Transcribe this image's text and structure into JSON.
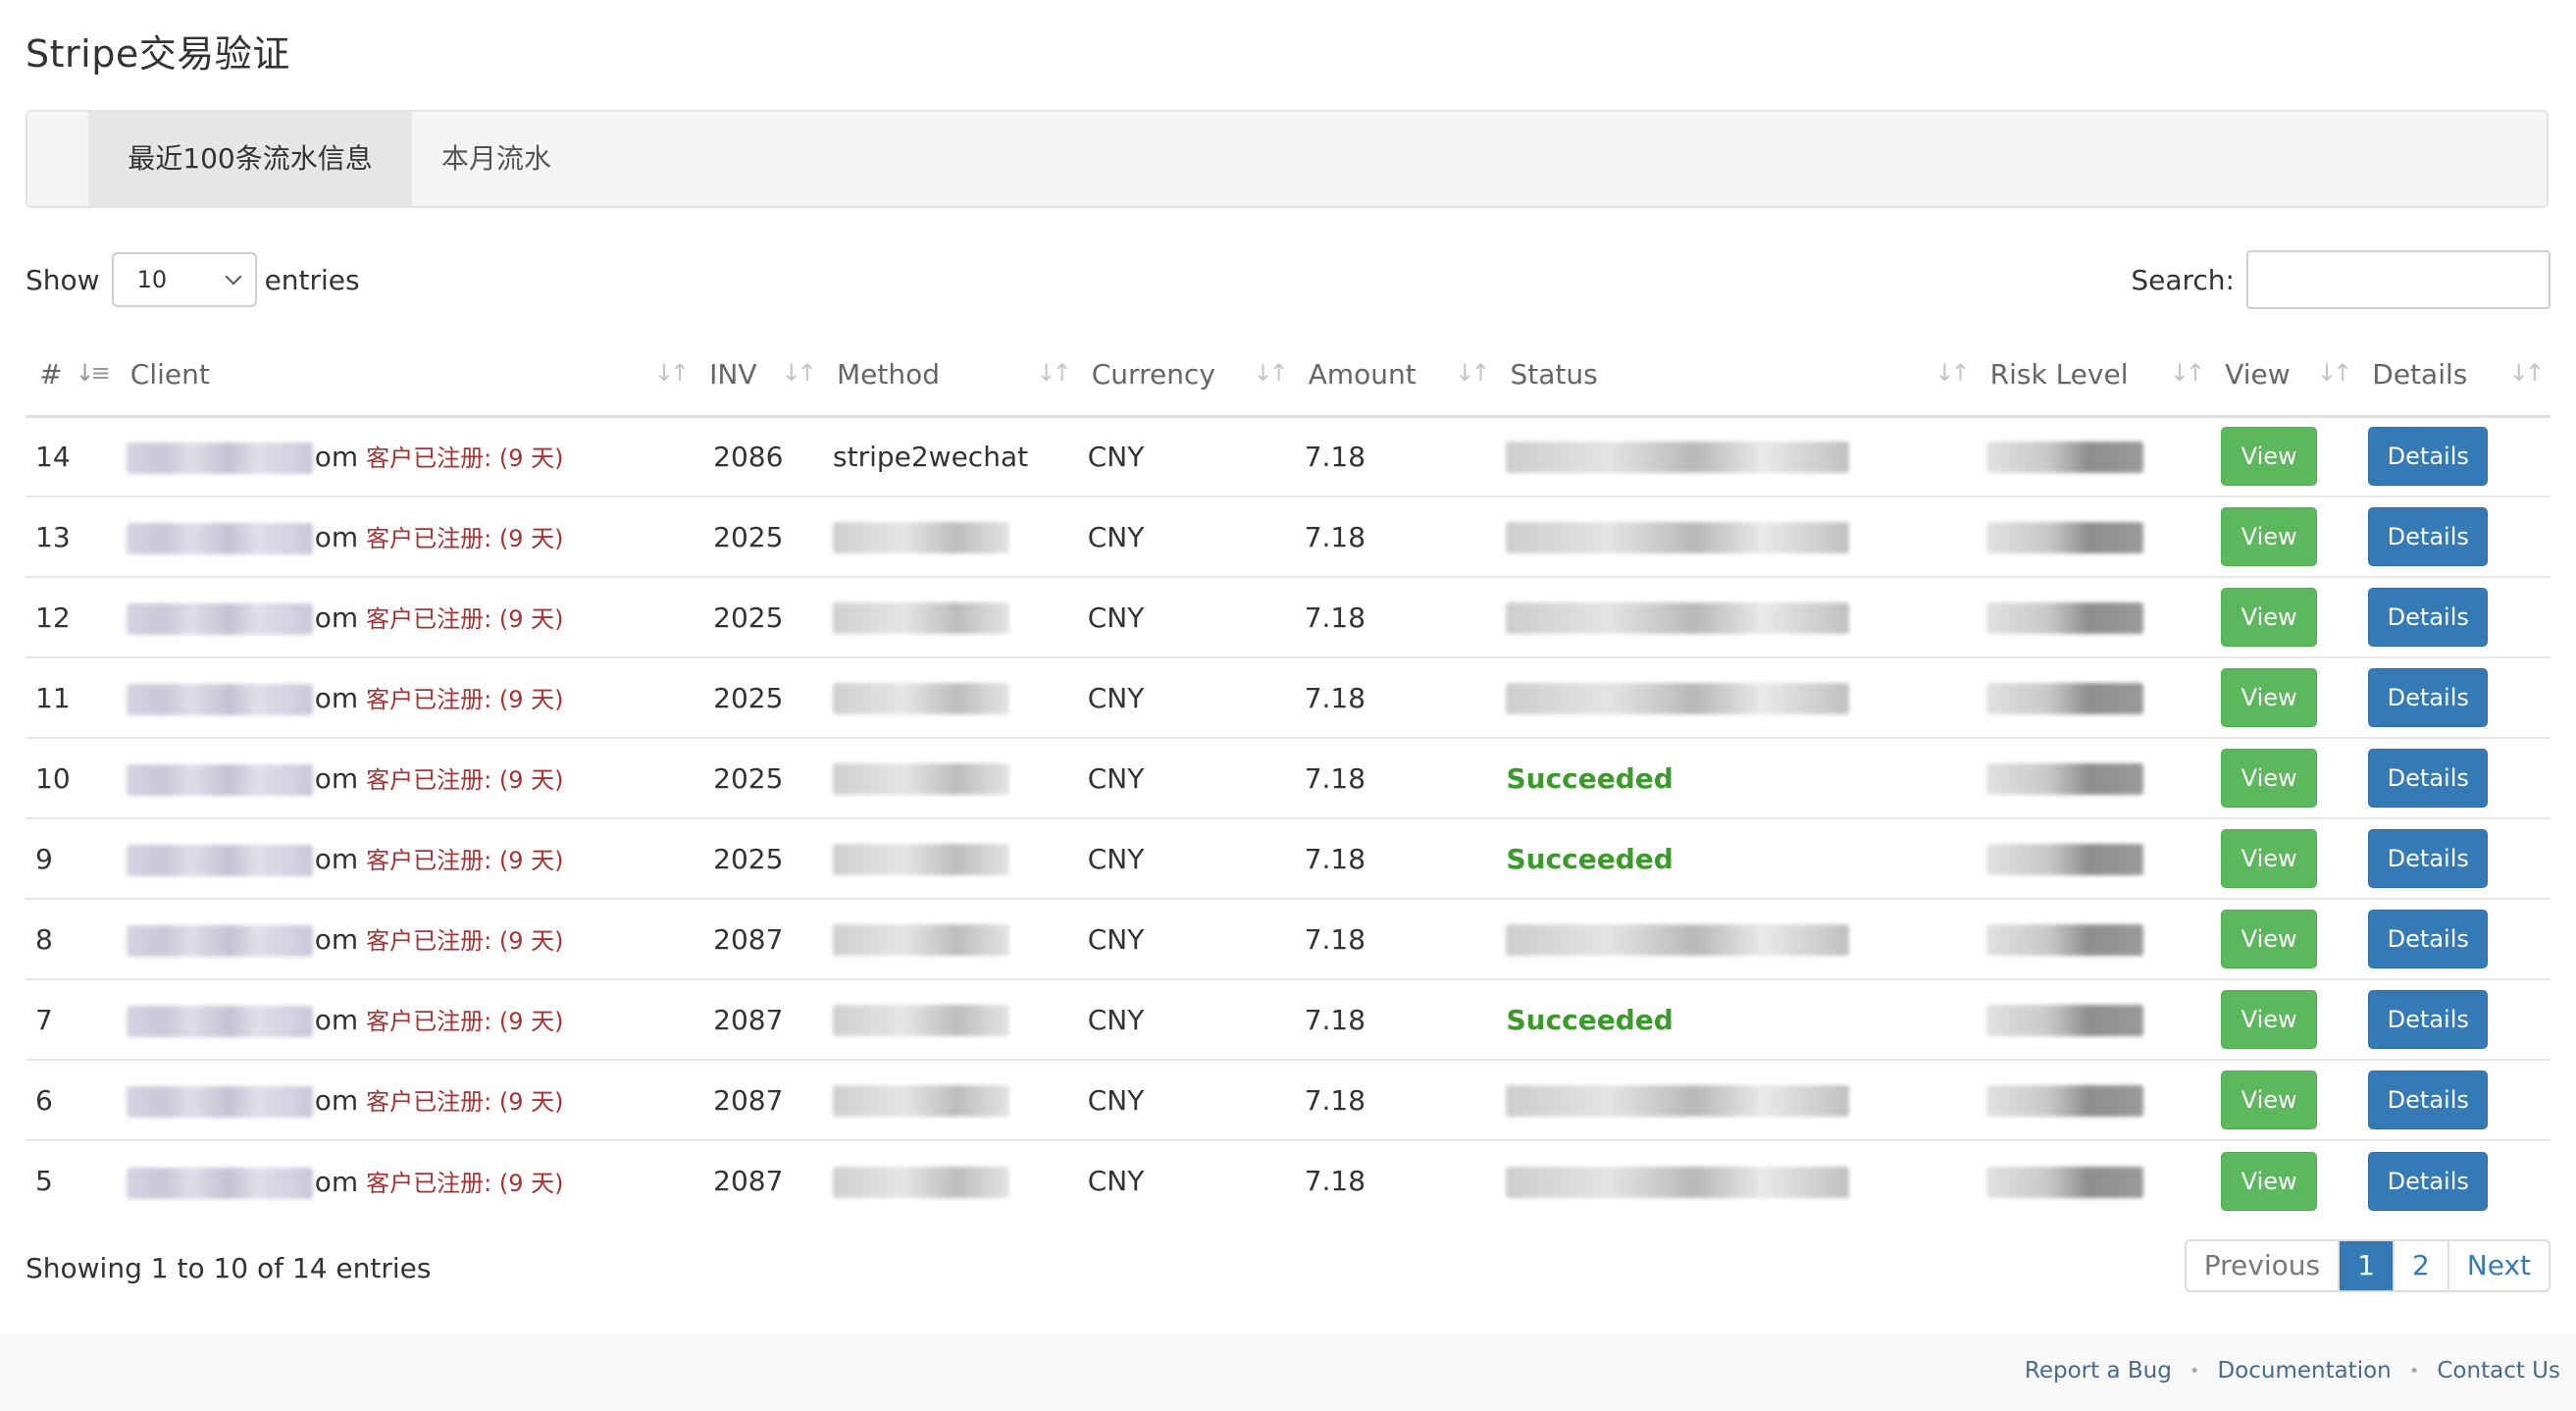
{
  "page": {
    "title": "Stripe交易验证"
  },
  "tabs": [
    {
      "label": "最近100条流水信息",
      "active": true
    },
    {
      "label": "本月流水",
      "active": false
    }
  ],
  "length": {
    "prefix": "Show",
    "value": "10",
    "suffix": "entries"
  },
  "search": {
    "label": "Search:",
    "value": ""
  },
  "table": {
    "columns": [
      "#",
      "Client",
      "INV",
      "Method",
      "Currency",
      "Amount",
      "Status",
      "Risk Level",
      "View",
      "Details"
    ],
    "rows": [
      {
        "id": "14",
        "client_domain": "om",
        "reg": "客户已注册: (9 天)",
        "inv": "2086",
        "method": "stripe2wechat",
        "currency": "CNY",
        "amount": "7.18",
        "status": "",
        "view": "View",
        "details": "Details"
      },
      {
        "id": "13",
        "client_domain": "om",
        "reg": "客户已注册: (9 天)",
        "inv": "2025",
        "method": "",
        "currency": "CNY",
        "amount": "7.18",
        "status": "",
        "view": "View",
        "details": "Details"
      },
      {
        "id": "12",
        "client_domain": "om",
        "reg": "客户已注册: (9 天)",
        "inv": "2025",
        "method": "",
        "currency": "CNY",
        "amount": "7.18",
        "status": "",
        "view": "View",
        "details": "Details"
      },
      {
        "id": "11",
        "client_domain": "om",
        "reg": "客户已注册: (9 天)",
        "inv": "2025",
        "method": "",
        "currency": "CNY",
        "amount": "7.18",
        "status": "",
        "view": "View",
        "details": "Details"
      },
      {
        "id": "10",
        "client_domain": "om",
        "reg": "客户已注册: (9 天)",
        "inv": "2025",
        "method": "",
        "currency": "CNY",
        "amount": "7.18",
        "status": "Succeeded",
        "view": "View",
        "details": "Details"
      },
      {
        "id": "9",
        "client_domain": "om",
        "reg": "客户已注册: (9 天)",
        "inv": "2025",
        "method": "",
        "currency": "CNY",
        "amount": "7.18",
        "status": "Succeeded",
        "view": "View",
        "details": "Details"
      },
      {
        "id": "8",
        "client_domain": "om",
        "reg": "客户已注册: (9 天)",
        "inv": "2087",
        "method": "",
        "currency": "CNY",
        "amount": "7.18",
        "status": "",
        "view": "View",
        "details": "Details"
      },
      {
        "id": "7",
        "client_domain": "om",
        "reg": "客户已注册: (9 天)",
        "inv": "2087",
        "method": "",
        "currency": "CNY",
        "amount": "7.18",
        "status": "Succeeded",
        "view": "View",
        "details": "Details"
      },
      {
        "id": "6",
        "client_domain": "om",
        "reg": "客户已注册: (9 天)",
        "inv": "2087",
        "method": "",
        "currency": "CNY",
        "amount": "7.18",
        "status": "",
        "view": "View",
        "details": "Details"
      },
      {
        "id": "5",
        "client_domain": "om",
        "reg": "客户已注册: (9 天)",
        "inv": "2087",
        "method": "",
        "currency": "CNY",
        "amount": "7.18",
        "status": "",
        "view": "View",
        "details": "Details"
      }
    ]
  },
  "info": "Showing 1 to 10 of 14 entries",
  "pagination": {
    "previous": "Previous",
    "pages": [
      "1",
      "2"
    ],
    "current": "1",
    "next": "Next"
  },
  "footer": {
    "links": [
      "Report a Bug",
      "Documentation",
      "Contact Us"
    ]
  },
  "colors": {
    "view_button": "#5cb85c",
    "details_button": "#337ab7",
    "success_text": "#3c9a2c",
    "registered_note": "#a83232"
  }
}
